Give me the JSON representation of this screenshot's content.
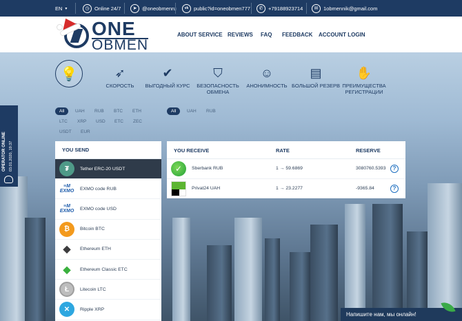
{
  "topbar": {
    "language": "EN",
    "online": "Online 24/7",
    "telegram": "@oneobmenru",
    "vk": "public?id=oneobmen777",
    "whatsapp": "+79188923714",
    "email": "1obmennik@gmail.com"
  },
  "logo": {
    "line1": "ONE",
    "line2": "OBMEN"
  },
  "nav": [
    "ABOUT SERVICE",
    "REVIEWS",
    "FAQ",
    "FEEDBACK",
    "ACCOUNT LOGIN"
  ],
  "features": [
    {
      "label": "СКОРОСТЬ",
      "icon": "paper-plane-icon"
    },
    {
      "label": "ВЫГОДНЫЙ КУРС",
      "icon": "chart-check-icon"
    },
    {
      "label": "БЕЗОПАСНОСТЬ ОБМЕНА",
      "icon": "shield-icon"
    },
    {
      "label": "АНОНИМНОСТЬ",
      "icon": "person-icon"
    },
    {
      "label": "БОЛЬШОЙ РЕЗЕРВ",
      "icon": "coins-stack-icon"
    },
    {
      "label": "ПРЕИМУЩЕСТВА РЕГИСТРАЦИИ",
      "icon": "handshake-icon"
    }
  ],
  "send_filters": [
    "All",
    "UAH",
    "RUB",
    "BTC",
    "ETH",
    "LTC",
    "XRP",
    "USD",
    "ETC",
    "ZEC",
    "USDT",
    "EUR"
  ],
  "receive_filters": [
    "All",
    "UAH",
    "RUB"
  ],
  "operator": {
    "status": "OPERATOR ONLINE",
    "time": "03.01.2020, 19:37"
  },
  "send": {
    "title": "YOU SEND",
    "items": [
      {
        "name": "Tether ERC-20 USDT",
        "icon": "tether-icon",
        "color": "#4f9a88"
      },
      {
        "name": "EXMO code RUB",
        "icon": "exmo-icon",
        "color": "#1e5cab"
      },
      {
        "name": "EXMO code USD",
        "icon": "exmo-icon",
        "color": "#1e5cab"
      },
      {
        "name": "Bitcoin BTC",
        "icon": "bitcoin-icon",
        "color": "#f39a1d"
      },
      {
        "name": "Ethereum ETH",
        "icon": "ethereum-icon",
        "color": "#3c3c3d"
      },
      {
        "name": "Ethereum Classic ETC",
        "icon": "ethereum-classic-icon",
        "color": "#3ab03e"
      },
      {
        "name": "Litecoin LTC",
        "icon": "litecoin-icon",
        "color": "#9e9e9e"
      },
      {
        "name": "Ripple XRP",
        "icon": "ripple-icon",
        "color": "#2ea7e0"
      }
    ]
  },
  "receive": {
    "col_receive": "YOU RECEIVE",
    "col_rate": "RATE",
    "col_reserve": "RESERVE",
    "rows": [
      {
        "name": "Sberbank RUB",
        "rate": "1 → 59.6869",
        "reserve": "3080760.5393",
        "icon": "sberbank-icon"
      },
      {
        "name": "Privat24 UAH",
        "rate": "1 → 23.2277",
        "reserve": "-9365.84",
        "icon": "privat24-icon"
      }
    ]
  },
  "chat": {
    "text": "Напишите нам, мы онлайн!"
  }
}
